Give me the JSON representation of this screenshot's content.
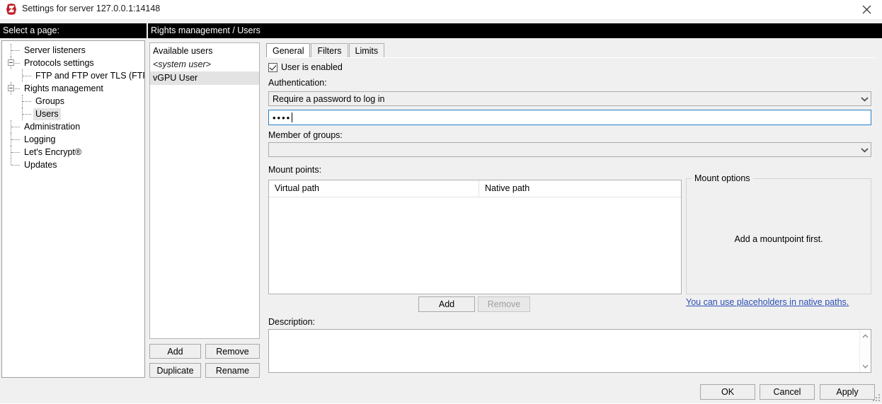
{
  "window": {
    "title": "Settings for server 127.0.0.1:14148",
    "icon": "filezilla-server-icon",
    "close_icon": "close-icon"
  },
  "headers": {
    "left": "Select a page:",
    "right": "Rights management / Users"
  },
  "sidebar": {
    "items": [
      {
        "label": "Server listeners",
        "level": 1,
        "expander": false,
        "selected": false
      },
      {
        "label": "Protocols settings",
        "level": 1,
        "expander": true,
        "selected": false
      },
      {
        "label": "FTP and FTP over TLS (FTPS)",
        "level": 2,
        "expander": false,
        "selected": false
      },
      {
        "label": "Rights management",
        "level": 1,
        "expander": true,
        "selected": false
      },
      {
        "label": "Groups",
        "level": 2,
        "expander": false,
        "selected": false
      },
      {
        "label": "Users",
        "level": 2,
        "expander": false,
        "selected": true
      },
      {
        "label": "Administration",
        "level": 1,
        "expander": false,
        "selected": false
      },
      {
        "label": "Logging",
        "level": 1,
        "expander": false,
        "selected": false
      },
      {
        "label": "Let's Encrypt®",
        "level": 1,
        "expander": false,
        "selected": false
      },
      {
        "label": "Updates",
        "level": 1,
        "expander": false,
        "selected": false
      }
    ]
  },
  "users_panel": {
    "header": "Available users",
    "items": [
      {
        "label": "<system user>",
        "italic": true,
        "selected": false
      },
      {
        "label": "vGPU User",
        "italic": false,
        "selected": true
      }
    ],
    "buttons": {
      "add": "Add",
      "remove": "Remove",
      "duplicate": "Duplicate",
      "rename": "Rename"
    }
  },
  "tabs": [
    {
      "label": "General",
      "active": true
    },
    {
      "label": "Filters",
      "active": false
    },
    {
      "label": "Limits",
      "active": false
    }
  ],
  "general": {
    "user_enabled_label": "User is enabled",
    "user_enabled_checked": true,
    "authentication_label": "Authentication:",
    "authentication_value": "Require a password to log in",
    "password_value": "••••",
    "member_of_groups_label": "Member of groups:",
    "member_of_groups_value": "",
    "mount_points_label": "Mount points:",
    "mount_columns": [
      "Virtual path",
      "Native path"
    ],
    "mount_rows": [],
    "mount_add_label": "Add",
    "mount_remove_label": "Remove",
    "mount_remove_disabled": true,
    "mount_options_legend": "Mount options",
    "mount_options_message": "Add a mountpoint first.",
    "placeholders_link": "You can use placeholders in native paths.",
    "description_label": "Description:",
    "description_value": ""
  },
  "dialog_buttons": {
    "ok": "OK",
    "cancel": "Cancel",
    "apply": "Apply"
  },
  "colors": {
    "header_bar": "#000000",
    "focus_border": "#2a7fc9",
    "link": "#2a4fb5",
    "selection": "#e3e3e3",
    "window_bg": "#f0f0f0"
  }
}
